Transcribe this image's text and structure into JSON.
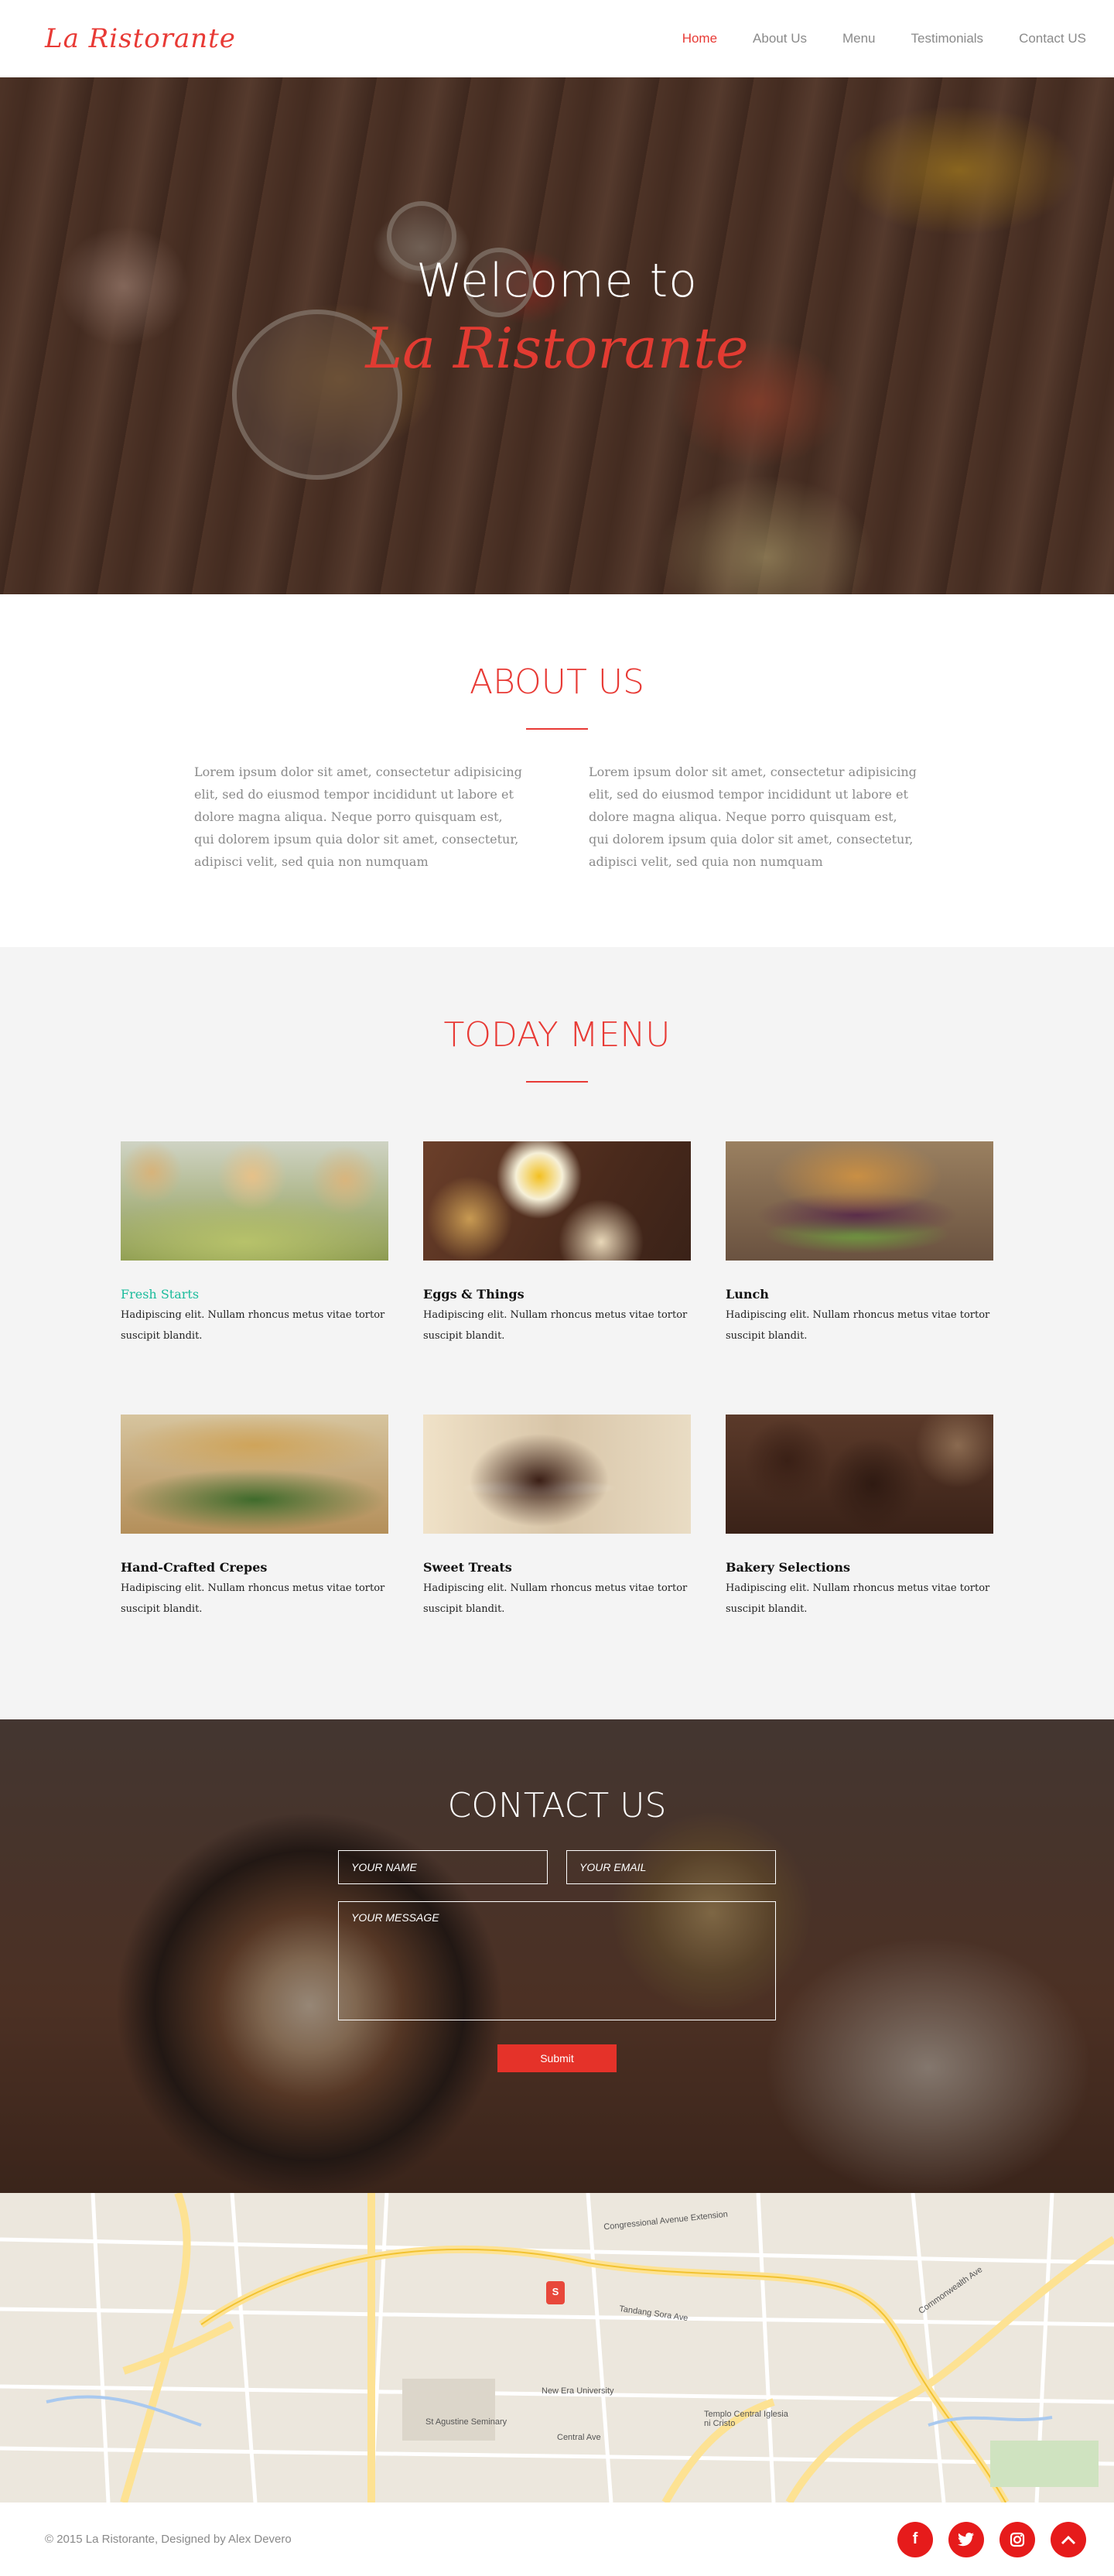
{
  "brand": "La Ristorante",
  "nav": {
    "items": [
      {
        "label": "Home"
      },
      {
        "label": "About Us"
      },
      {
        "label": "Menu"
      },
      {
        "label": "Testimonials"
      },
      {
        "label": "Contact US"
      }
    ],
    "active": "Home"
  },
  "hero": {
    "welcome": "Welcome to",
    "brand": "La Ristorante"
  },
  "about": {
    "title": "ABOUT US",
    "col1": "Lorem ipsum dolor sit amet, consectetur adipisicing elit, sed do eiusmod tempor incididunt ut labore et dolore magna aliqua.  Neque porro quisquam est, qui dolorem ipsum quia dolor sit amet, consectetur, adipisci velit, sed quia non numquam",
    "col2": "Lorem ipsum dolor sit amet, consectetur adipisicing elit, sed do eiusmod tempor incididunt ut labore et dolore magna aliqua.  Neque porro quisquam est, qui dolorem ipsum quia dolor sit amet, consectetur, adipisci velit, sed quia non numquam"
  },
  "menu": {
    "title": "TODAY MENU",
    "items": [
      {
        "name": "Fresh Starts",
        "desc": "Hadipiscing elit. Nullam rhoncus metus vitae tortor suscipit blandit."
      },
      {
        "name": "Eggs & Things",
        "desc": "Hadipiscing elit. Nullam rhoncus metus vitae tortor suscipit blandit."
      },
      {
        "name": "Lunch",
        "desc": "Hadipiscing elit. Nullam rhoncus metus vitae tortor suscipit blandit."
      },
      {
        "name": "Hand-Crafted Crepes",
        "desc": "Hadipiscing elit. Nullam rhoncus metus vitae tortor suscipit blandit."
      },
      {
        "name": "Sweet Treats",
        "desc": "Hadipiscing elit. Nullam rhoncus metus vitae tortor suscipit blandit."
      },
      {
        "name": "Bakery Selections",
        "desc": "Hadipiscing elit. Nullam rhoncus metus vitae tortor suscipit blandit."
      }
    ]
  },
  "contact": {
    "title": "CONTACT US",
    "name_placeholder": "YOUR NAME",
    "email_placeholder": "YOUR EMAIL",
    "message_placeholder": "YOUR MESSAGE",
    "submit": "Submit"
  },
  "map": {
    "pin_label": "S",
    "labels": [
      "Congressional Avenue Extension",
      "Commonwealth Ave",
      "Tandang Sora Ave",
      "New Era University",
      "Central Ave",
      "Templo Central Iglesia ni Cristo",
      "St Agustine Seminary"
    ]
  },
  "footer": {
    "copyright": "© 2015 La Ristorante, Designed by Alex Devero"
  },
  "social": [
    "facebook-icon",
    "twitter-icon",
    "instagram-icon",
    "scroll-top-icon"
  ],
  "colors": {
    "accent": "#e83a35",
    "teal": "#1abc9c",
    "social": "#e61b1b"
  }
}
